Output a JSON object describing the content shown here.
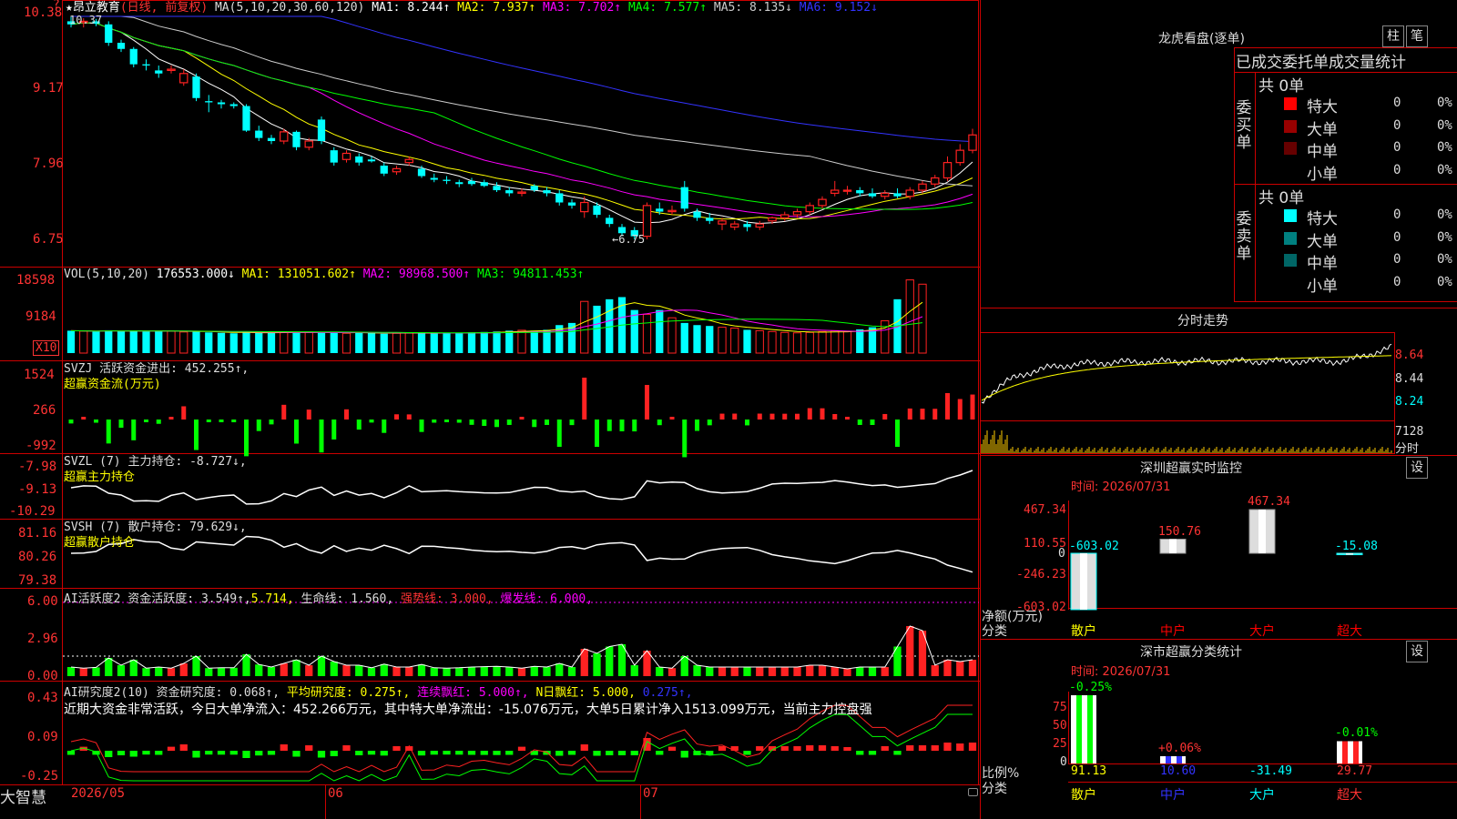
{
  "main": {
    "star": "★",
    "stock": "昂立教育",
    "period": "(日线, 前复权)",
    "ma_label": "MA(5,10,20,30,60,120)",
    "ma": [
      {
        "t": "MA1: 8.244↑",
        "c": "#ffffff"
      },
      {
        "t": "MA2: 7.937↑",
        "c": "#ffff00"
      },
      {
        "t": "MA3: 7.702↑",
        "c": "#ff00ff"
      },
      {
        "t": "MA4: 7.577↑",
        "c": "#00ff00"
      },
      {
        "t": "MA5: 8.135↓",
        "c": "#cccccc"
      },
      {
        "t": "MA6: 9.152↓",
        "c": "#3333ff"
      }
    ],
    "y_ticks": [
      "10.38",
      "9.17",
      "7.96",
      "6.75"
    ],
    "high_label": "10.37",
    "low_label": "←6.75",
    "corner_mark": "?"
  },
  "vol": {
    "title": "VOL(5,10,20)",
    "value": "176553.000↓",
    "ma": [
      {
        "t": "MA1: 131051.602↑",
        "c": "#ffff00"
      },
      {
        "t": "MA2: 98968.500↑",
        "c": "#ff00ff"
      },
      {
        "t": "MA3: 94811.453↑",
        "c": "#00ff00"
      }
    ],
    "y_ticks": [
      "18598",
      "9184"
    ],
    "unit": "X10"
  },
  "svzj": {
    "title": "SVZJ  活跃资金进出: 452.255↑,",
    "subtitle": "超赢资金流(万元)",
    "y_ticks": [
      "1524",
      "266",
      "-992"
    ]
  },
  "svzl": {
    "title": "SVZL (7) 主力持仓: -8.727↓,",
    "subtitle": "超赢主力持仓",
    "y_ticks": [
      "-7.98",
      "-9.13",
      "-10.29"
    ]
  },
  "svsh": {
    "title": "SVSH (7) 散户持仓: 79.629↓,",
    "subtitle": "超赢散户持仓",
    "y_ticks": [
      "81.16",
      "80.26",
      "79.38"
    ]
  },
  "ai_act": {
    "title": "AI活跃度2 资金活跃度: 3.549↑,",
    "v2": "5.714,",
    "v3": "生命线: 1.560,",
    "v4": "强势线: 3.000,",
    "v5": "爆发线: 6.000,",
    "y_ticks": [
      "6.00",
      "2.96",
      "0.00"
    ]
  },
  "ai_res": {
    "title": "AI研究度2(10) 资金研究度: 0.068↑,",
    "v2": "平均研究度: 0.275↑,",
    "v3": "连续飘红: 5.000↑,",
    "v4": "N日飘红: 5.000,",
    "v5": "0.275↑,",
    "summary": "近期大资金非常活跃，今日大单净流入：452.266万元，其中特大单净流出：-15.076万元，大单5日累计净入1513.099万元，当前主力控盘强",
    "y_ticks": [
      "0.43",
      "0.09",
      "-0.25"
    ]
  },
  "xaxis": [
    "2026/05",
    "06",
    "07"
  ],
  "brand": "大智慧",
  "right": {
    "lhb_title": "龙虎看盘(逐单)",
    "btn_bar": "柱",
    "btn_bi": "笔",
    "order_title": "已成交委托单成交量统计",
    "buy_side": "委买单",
    "sell_side": "委卖单",
    "buy_total": "共 0单",
    "sell_total": "共 0单",
    "buy_rows": [
      {
        "label": "特大",
        "c": "#ff0000",
        "v1": "0",
        "v2": "0%"
      },
      {
        "label": "大单",
        "c": "#990000",
        "v1": "0",
        "v2": "0%"
      },
      {
        "label": "中单",
        "c": "#660000",
        "v1": "0",
        "v2": "0%"
      },
      {
        "label": "小单",
        "c": "",
        "v1": "0",
        "v2": "0%"
      }
    ],
    "sell_rows": [
      {
        "label": "特大",
        "c": "#00ffff",
        "v1": "0",
        "v2": "0%"
      },
      {
        "label": "大单",
        "c": "#008080",
        "v1": "0",
        "v2": "0%"
      },
      {
        "label": "中单",
        "c": "#006666",
        "v1": "0",
        "v2": "0%"
      },
      {
        "label": "小单",
        "c": "",
        "v1": "0",
        "v2": "0%"
      }
    ],
    "intraday_title": "分时走势",
    "intraday_ticks": [
      "8.64",
      "8.44",
      "8.24"
    ],
    "intraday_vol": "7128",
    "intraday_unit": "分时",
    "sz_title": "深圳超赢实时监控",
    "sz_btn": "设",
    "sz_time": "时间: 2026/07/31",
    "sz_ticks": [
      "467.34",
      "110.55",
      "0",
      "-246.23",
      "-603.02"
    ],
    "sz_ylabel": "净额(万元)",
    "sz_xlabel": "分类",
    "sz_bars": [
      {
        "cat": "散户",
        "val": "-603.02",
        "cc": "#ffff00"
      },
      {
        "cat": "中户",
        "val": "150.76",
        "cc": "#ff0000"
      },
      {
        "cat": "大户",
        "val": "467.34",
        "cc": "#ff0000"
      },
      {
        "cat": "超大",
        "val": "-15.08",
        "cc": "#ff0000"
      }
    ],
    "cls_title": "深市超赢分类统计",
    "cls_btn": "设",
    "cls_time": "时间: 2026/07/31",
    "cls_ticks": [
      "75",
      "50",
      "25",
      "0"
    ],
    "cls_ylabel": "比例%",
    "cls_xlabel": "分类",
    "cls_bars": [
      {
        "cat": "散户",
        "top": "-0.25%",
        "bottom": "91.13"
      },
      {
        "cat": "中户",
        "top": "+0.06%",
        "bottom": "10.60"
      },
      {
        "cat": "大户",
        "top": "",
        "bottom": "-31.49"
      },
      {
        "cat": "超大",
        "top": "-0.01%",
        "bottom": "29.77"
      }
    ]
  },
  "chart_data": [
    {
      "type": "candlestick",
      "title": "昂立教育(日线, 前复权)",
      "ylim": [
        6.75,
        10.38
      ],
      "candles": [
        {
          "o": 10.3,
          "h": 10.37,
          "l": 10.2,
          "c": 10.25
        },
        {
          "o": 10.28,
          "h": 10.35,
          "l": 10.2,
          "c": 10.3
        },
        {
          "o": 10.3,
          "h": 10.34,
          "l": 10.22,
          "c": 10.26
        },
        {
          "o": 10.25,
          "h": 10.3,
          "l": 9.9,
          "c": 9.95
        },
        {
          "o": 9.95,
          "h": 10.0,
          "l": 9.8,
          "c": 9.85
        },
        {
          "o": 9.85,
          "h": 9.88,
          "l": 9.55,
          "c": 9.6
        },
        {
          "o": 9.6,
          "h": 9.68,
          "l": 9.5,
          "c": 9.58
        },
        {
          "o": 9.5,
          "h": 9.58,
          "l": 9.38,
          "c": 9.45
        },
        {
          "o": 9.5,
          "h": 9.58,
          "l": 9.45,
          "c": 9.52
        },
        {
          "o": 9.3,
          "h": 9.52,
          "l": 9.25,
          "c": 9.45
        },
        {
          "o": 9.4,
          "h": 9.45,
          "l": 9.0,
          "c": 9.05
        },
        {
          "o": 9.0,
          "h": 9.1,
          "l": 8.82,
          "c": 8.98
        },
        {
          "o": 8.98,
          "h": 9.02,
          "l": 8.88,
          "c": 8.95
        },
        {
          "o": 8.95,
          "h": 8.98,
          "l": 8.88,
          "c": 8.92
        },
        {
          "o": 8.92,
          "h": 8.95,
          "l": 8.5,
          "c": 8.52
        },
        {
          "o": 8.52,
          "h": 8.6,
          "l": 8.35,
          "c": 8.4
        },
        {
          "o": 8.4,
          "h": 8.45,
          "l": 8.3,
          "c": 8.35
        },
        {
          "o": 8.35,
          "h": 8.55,
          "l": 8.3,
          "c": 8.5
        },
        {
          "o": 8.5,
          "h": 8.52,
          "l": 8.2,
          "c": 8.25
        },
        {
          "o": 8.25,
          "h": 8.4,
          "l": 8.2,
          "c": 8.35
        },
        {
          "o": 8.7,
          "h": 8.75,
          "l": 8.3,
          "c": 8.35
        },
        {
          "o": 8.2,
          "h": 8.25,
          "l": 7.95,
          "c": 8.0
        },
        {
          "o": 8.05,
          "h": 8.2,
          "l": 8.0,
          "c": 8.15
        },
        {
          "o": 8.1,
          "h": 8.15,
          "l": 7.95,
          "c": 8.0
        },
        {
          "o": 8.05,
          "h": 8.1,
          "l": 8.0,
          "c": 8.02
        },
        {
          "o": 7.95,
          "h": 8.0,
          "l": 7.78,
          "c": 7.82
        },
        {
          "o": 7.85,
          "h": 7.95,
          "l": 7.8,
          "c": 7.9
        },
        {
          "o": 8.0,
          "h": 8.1,
          "l": 7.95,
          "c": 8.05
        },
        {
          "o": 7.9,
          "h": 7.95,
          "l": 7.75,
          "c": 7.78
        },
        {
          "o": 7.75,
          "h": 7.82,
          "l": 7.68,
          "c": 7.72
        },
        {
          "o": 7.72,
          "h": 7.78,
          "l": 7.65,
          "c": 7.7
        },
        {
          "o": 7.68,
          "h": 7.72,
          "l": 7.6,
          "c": 7.65
        },
        {
          "o": 7.7,
          "h": 7.75,
          "l": 7.62,
          "c": 7.65
        },
        {
          "o": 7.68,
          "h": 7.72,
          "l": 7.6,
          "c": 7.62
        },
        {
          "o": 7.62,
          "h": 7.68,
          "l": 7.52,
          "c": 7.55
        },
        {
          "o": 7.55,
          "h": 7.6,
          "l": 7.45,
          "c": 7.5
        },
        {
          "o": 7.5,
          "h": 7.58,
          "l": 7.45,
          "c": 7.52
        },
        {
          "o": 7.62,
          "h": 7.65,
          "l": 7.52,
          "c": 7.55
        },
        {
          "o": 7.55,
          "h": 7.6,
          "l": 7.45,
          "c": 7.5
        },
        {
          "o": 7.5,
          "h": 7.55,
          "l": 7.3,
          "c": 7.35
        },
        {
          "o": 7.35,
          "h": 7.4,
          "l": 7.25,
          "c": 7.3
        },
        {
          "o": 7.2,
          "h": 7.45,
          "l": 7.1,
          "c": 7.35
        },
        {
          "o": 7.3,
          "h": 7.35,
          "l": 7.1,
          "c": 7.15
        },
        {
          "o": 7.1,
          "h": 7.15,
          "l": 6.95,
          "c": 7.0
        },
        {
          "o": 6.95,
          "h": 7.0,
          "l": 6.8,
          "c": 6.85
        },
        {
          "o": 6.9,
          "h": 6.95,
          "l": 6.75,
          "c": 6.8
        },
        {
          "o": 6.8,
          "h": 7.35,
          "l": 6.75,
          "c": 7.3
        },
        {
          "o": 7.25,
          "h": 7.35,
          "l": 7.15,
          "c": 7.2
        },
        {
          "o": 7.2,
          "h": 7.3,
          "l": 7.15,
          "c": 7.22
        },
        {
          "o": 7.6,
          "h": 7.7,
          "l": 7.2,
          "c": 7.25
        },
        {
          "o": 7.2,
          "h": 7.25,
          "l": 7.05,
          "c": 7.1
        },
        {
          "o": 7.1,
          "h": 7.18,
          "l": 7.0,
          "c": 7.05
        },
        {
          "o": 7.0,
          "h": 7.1,
          "l": 6.9,
          "c": 7.05
        },
        {
          "o": 6.95,
          "h": 7.05,
          "l": 6.9,
          "c": 7.0
        },
        {
          "o": 7.0,
          "h": 7.05,
          "l": 6.88,
          "c": 6.95
        },
        {
          "o": 6.95,
          "h": 7.05,
          "l": 6.9,
          "c": 7.0
        },
        {
          "o": 7.05,
          "h": 7.12,
          "l": 7.0,
          "c": 7.1
        },
        {
          "o": 7.1,
          "h": 7.2,
          "l": 7.05,
          "c": 7.15
        },
        {
          "o": 7.15,
          "h": 7.25,
          "l": 7.1,
          "c": 7.2
        },
        {
          "o": 7.2,
          "h": 7.35,
          "l": 7.15,
          "c": 7.3
        },
        {
          "o": 7.3,
          "h": 7.45,
          "l": 7.25,
          "c": 7.4
        },
        {
          "o": 7.5,
          "h": 7.7,
          "l": 7.45,
          "c": 7.55
        },
        {
          "o": 7.55,
          "h": 7.62,
          "l": 7.48,
          "c": 7.55
        },
        {
          "o": 7.55,
          "h": 7.6,
          "l": 7.45,
          "c": 7.5
        },
        {
          "o": 7.5,
          "h": 7.58,
          "l": 7.42,
          "c": 7.45
        },
        {
          "o": 7.45,
          "h": 7.55,
          "l": 7.4,
          "c": 7.5
        },
        {
          "o": 7.5,
          "h": 7.58,
          "l": 7.42,
          "c": 7.45
        },
        {
          "o": 7.45,
          "h": 7.6,
          "l": 7.4,
          "c": 7.55
        },
        {
          "o": 7.55,
          "h": 7.7,
          "l": 7.5,
          "c": 7.65
        },
        {
          "o": 7.65,
          "h": 7.8,
          "l": 7.6,
          "c": 7.75
        },
        {
          "o": 7.75,
          "h": 8.1,
          "l": 7.7,
          "c": 8.0
        },
        {
          "o": 8.0,
          "h": 8.3,
          "l": 7.95,
          "c": 8.2
        },
        {
          "o": 8.2,
          "h": 8.55,
          "l": 8.15,
          "c": 8.45
        }
      ],
      "ma_series": [
        {
          "name": "MA1",
          "color": "#ffffff"
        },
        {
          "name": "MA2",
          "color": "#ffff00"
        },
        {
          "name": "MA3",
          "color": "#ff00ff"
        },
        {
          "name": "MA4",
          "color": "#00ff00"
        },
        {
          "name": "MA5",
          "color": "#cccccc"
        },
        {
          "name": "MA6",
          "color": "#3333ff"
        }
      ]
    },
    {
      "type": "bar",
      "title": "VOL(5,10,20)",
      "ylim": [
        0,
        18598
      ],
      "values": [
        5200,
        5100,
        5000,
        5300,
        5100,
        5200,
        5000,
        5200,
        5100,
        4900,
        5000,
        4800,
        4700,
        4600,
        4900,
        4700,
        4800,
        4800,
        4700,
        4900,
        4800,
        4700,
        4600,
        4800,
        4700,
        4500,
        4600,
        4700,
        4700,
        4600,
        4600,
        4700,
        4800,
        4900,
        5000,
        5200,
        5300,
        5200,
        5400,
        6500,
        7000,
        12000,
        11000,
        12500,
        13000,
        10000,
        9000,
        10000,
        8200,
        7000,
        6500,
        6300,
        6000,
        5800,
        5400,
        5200,
        5000,
        4800,
        4700,
        4800,
        5000,
        5200,
        5000,
        5500,
        6000,
        7500,
        12500,
        17000,
        16000
      ]
    }
  ]
}
